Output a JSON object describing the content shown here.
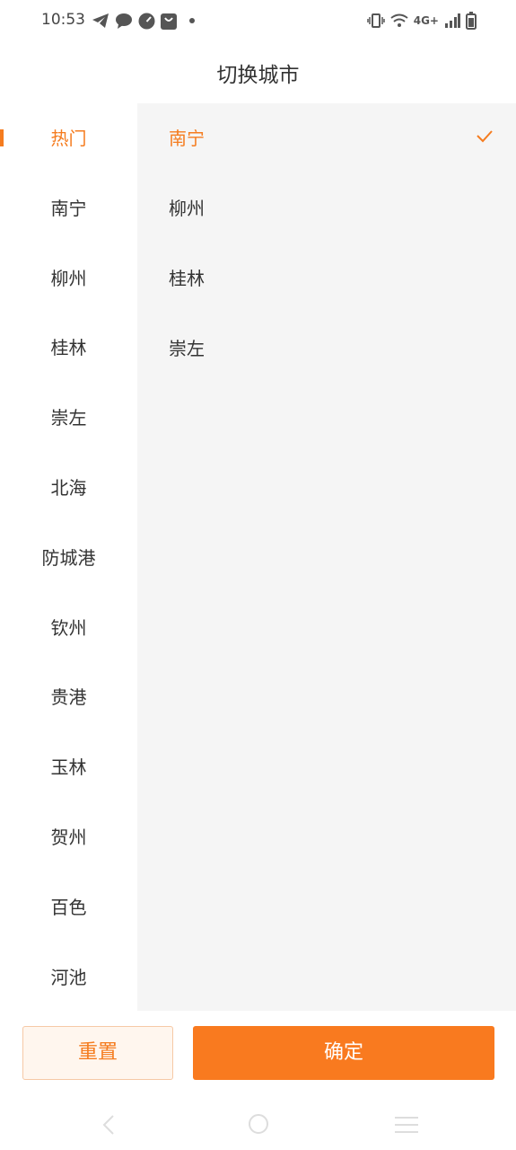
{
  "status_bar": {
    "time": "10:53",
    "network": "4G+",
    "left_icons": [
      "telegram-icon",
      "chat-bubble-icon",
      "speedometer-icon",
      "shopping-bag-icon",
      "dot-icon"
    ],
    "right_icons": [
      "vibrate-icon",
      "wifi-icon",
      "signal-icon",
      "battery-icon"
    ]
  },
  "header": {
    "title": "切换城市"
  },
  "categories": [
    {
      "label": "热门",
      "active": true
    },
    {
      "label": "南宁"
    },
    {
      "label": "柳州"
    },
    {
      "label": "桂林"
    },
    {
      "label": "崇左"
    },
    {
      "label": "北海"
    },
    {
      "label": "防城港"
    },
    {
      "label": "钦州"
    },
    {
      "label": "贵港"
    },
    {
      "label": "玉林"
    },
    {
      "label": "贺州"
    },
    {
      "label": "百色"
    },
    {
      "label": "河池"
    }
  ],
  "cities": [
    {
      "label": "南宁",
      "selected": true
    },
    {
      "label": "柳州"
    },
    {
      "label": "桂林"
    },
    {
      "label": "崇左"
    }
  ],
  "buttons": {
    "reset_label": "重置",
    "confirm_label": "确定"
  },
  "colors": {
    "accent": "#f57c1f",
    "panel_bg": "#f5f5f5",
    "text": "#333333"
  }
}
